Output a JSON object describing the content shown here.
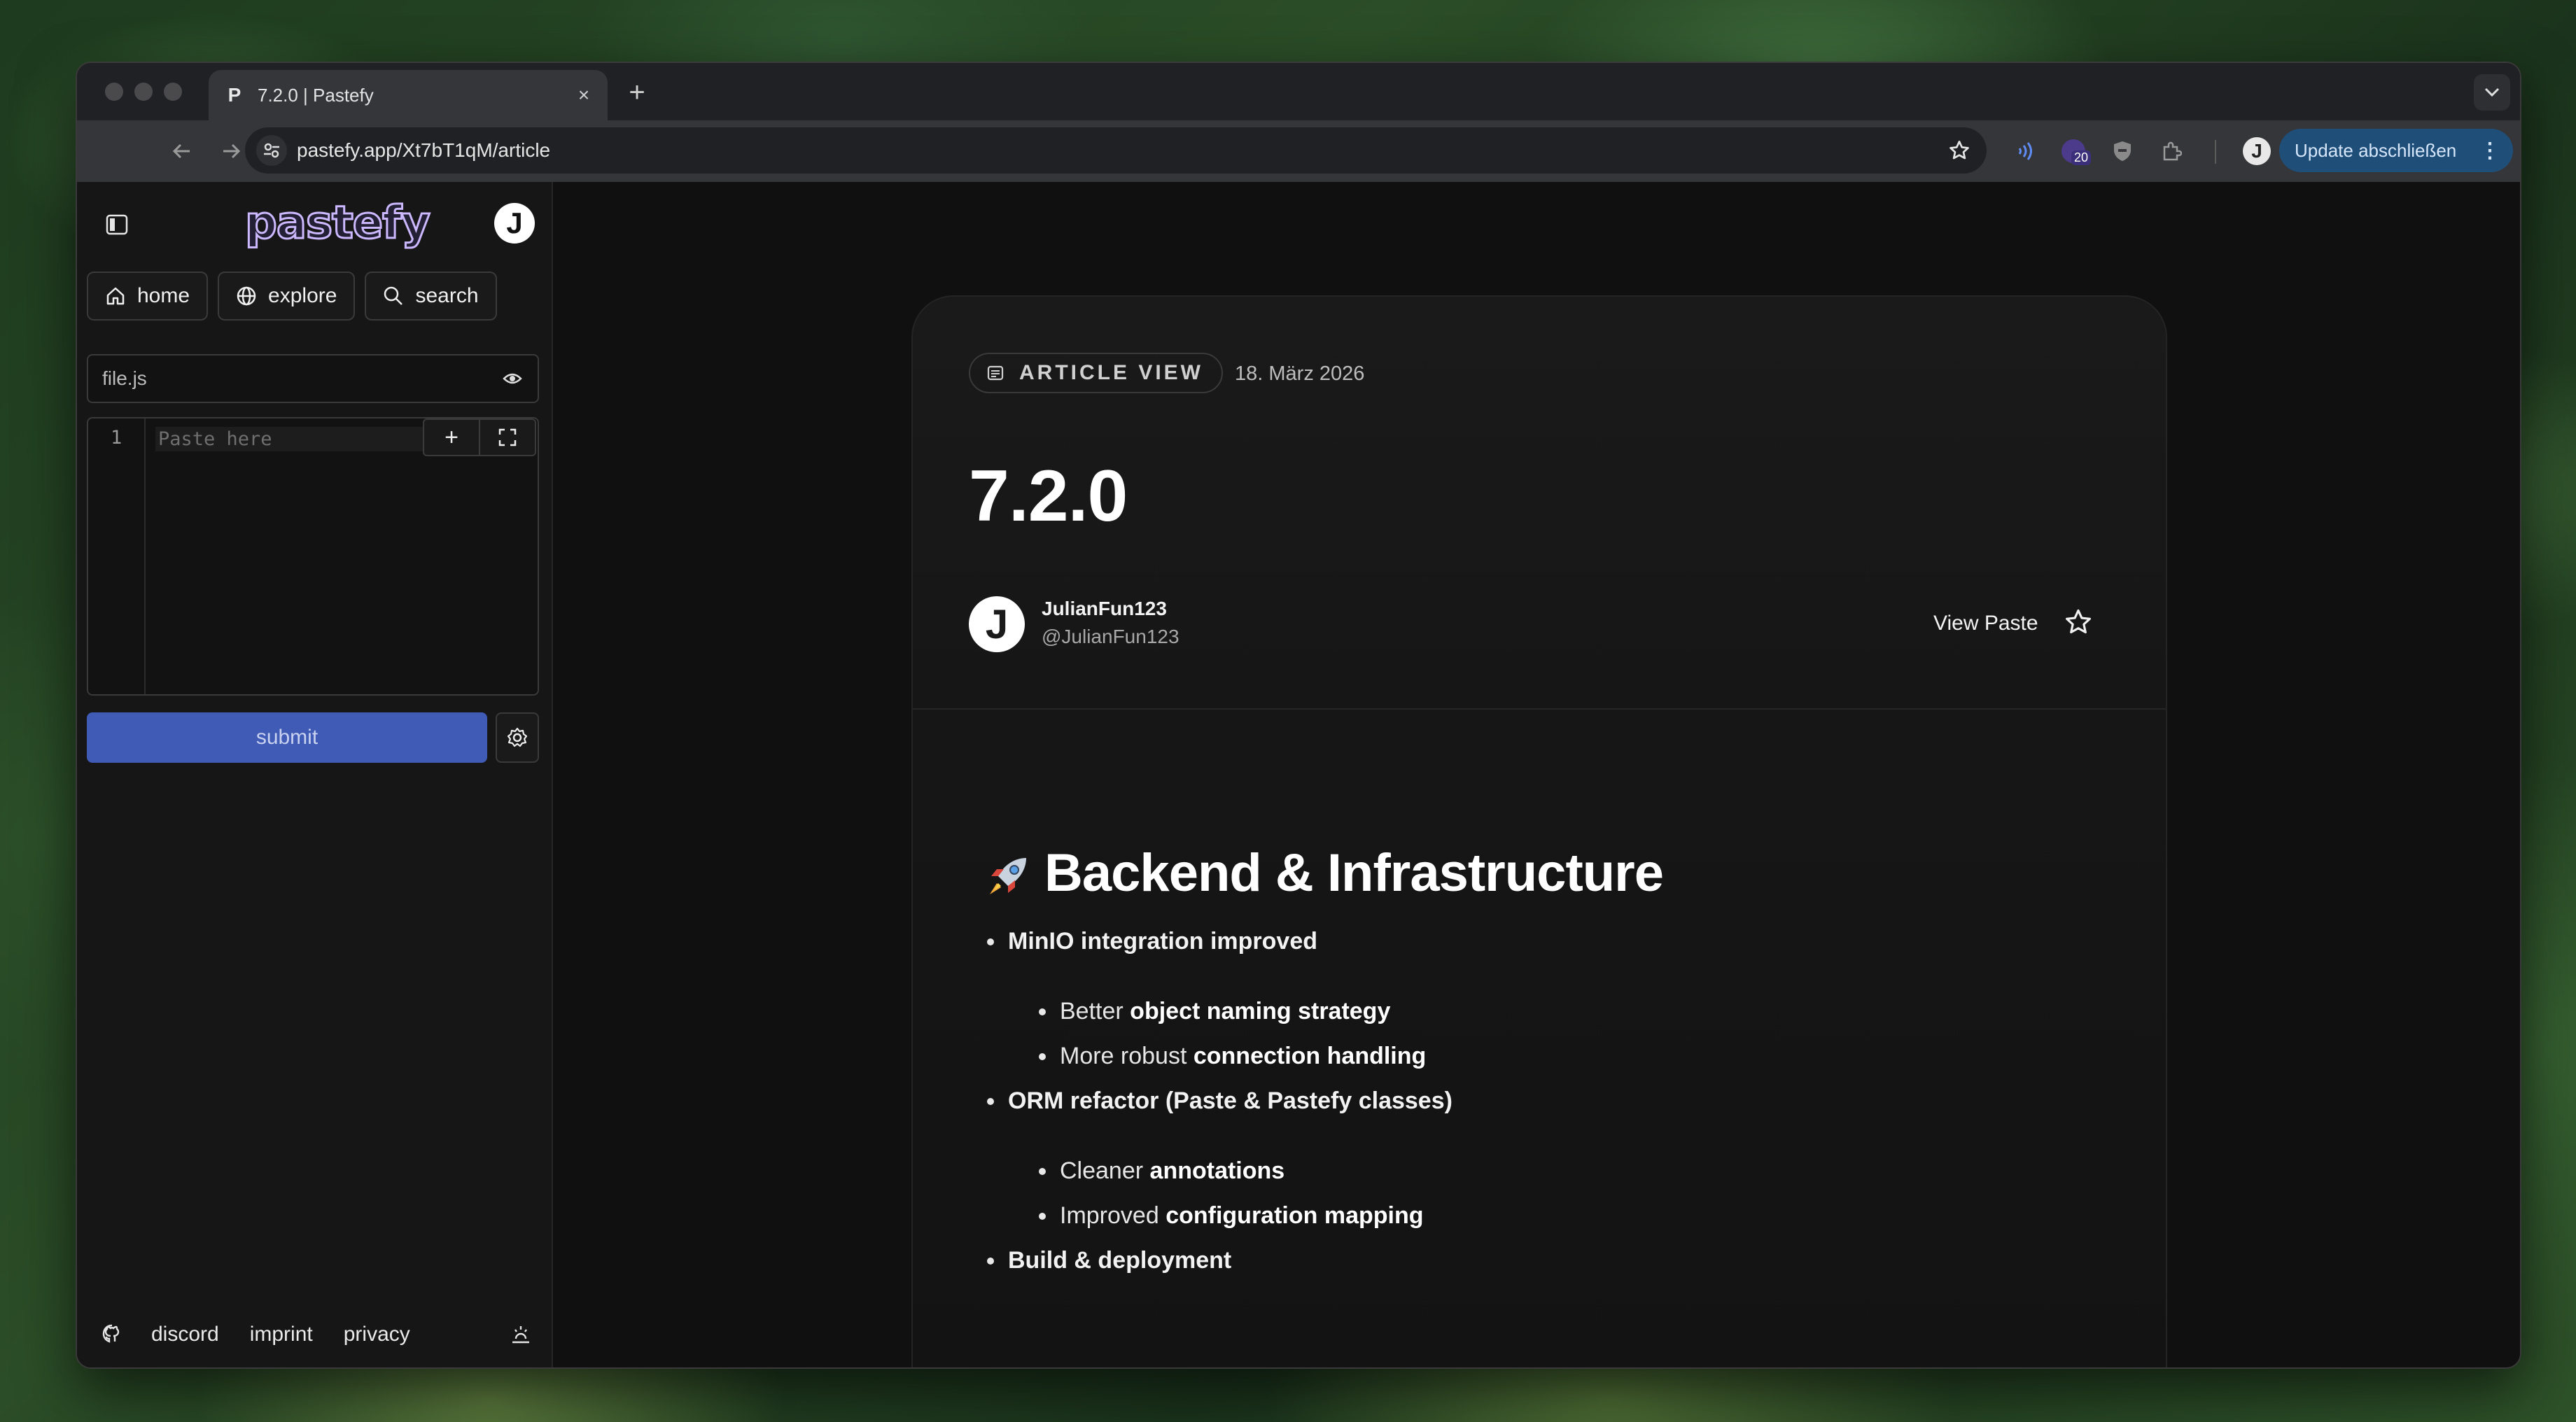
{
  "browser": {
    "tab_title": "7.2.0 | Pastefy",
    "url": "pastefy.app/Xt7bT1qM/article",
    "extension_badge": "20",
    "update_button": "Update abschließen",
    "tab_close": "×",
    "new_tab": "+",
    "favicon": "P"
  },
  "sidebar": {
    "logo": "pastefy",
    "avatar_initial": "J",
    "nav": [
      {
        "label": "home",
        "icon": "home-icon"
      },
      {
        "label": "explore",
        "icon": "globe-icon"
      },
      {
        "label": "search",
        "icon": "search-icon"
      }
    ],
    "filename_value": "file.js",
    "editor": {
      "line_number": "1",
      "placeholder": "Paste here",
      "add_symbol": "+"
    },
    "submit_label": "submit",
    "footer": {
      "links": [
        "discord",
        "imprint",
        "privacy"
      ]
    }
  },
  "article": {
    "badge": "ARTICLE VIEW",
    "date": "18. März 2026",
    "title": "7.2.0",
    "author_initial": "J",
    "author_name": "JulianFun123",
    "author_handle": "@JulianFun123",
    "view_paste": "View Paste",
    "heading": "Backend & Infrastructure",
    "items": [
      {
        "label": "MinIO integration improved",
        "sub": [
          {
            "prefix": "Better",
            "strong": "object naming strategy"
          },
          {
            "prefix": "More robust",
            "strong": "connection handling"
          }
        ]
      },
      {
        "label": "ORM refactor (Paste & Pastefy classes)",
        "sub": [
          {
            "prefix": "Cleaner",
            "strong": "annotations"
          },
          {
            "prefix": "Improved",
            "strong": "configuration mapping"
          }
        ]
      },
      {
        "label": "Build & deployment",
        "sub": []
      }
    ]
  },
  "colors": {
    "accent_button": "#3f5bb5",
    "update_button": "#1f4e79",
    "background": "#101010"
  }
}
